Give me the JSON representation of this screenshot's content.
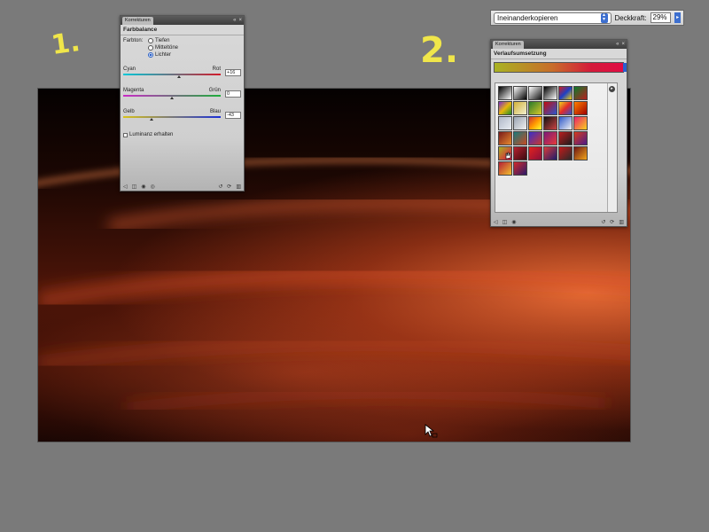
{
  "options_bar": {
    "blend_mode": "Ineinanderkopieren",
    "opacity_label": "Deckkraft:",
    "opacity_value": "29%"
  },
  "annotations": {
    "step1": "1.",
    "step2": "2."
  },
  "panel_color_balance": {
    "tab": "Korrekturen",
    "title": "Farbbalance",
    "tone_label": "Farbton:",
    "tones": [
      {
        "label": "Tiefen",
        "selected": false
      },
      {
        "label": "Mitteltöne",
        "selected": false
      },
      {
        "label": "Lichter",
        "selected": true
      }
    ],
    "sliders": [
      {
        "left": "Cyan",
        "right": "Rot",
        "value": "+16",
        "position": 0.57
      },
      {
        "left": "Magenta",
        "right": "Grün",
        "value": "0",
        "position": 0.5
      },
      {
        "left": "Gelb",
        "right": "Blau",
        "value": "-43",
        "position": 0.29
      }
    ],
    "luminance_label": "Luminanz erhalten",
    "luminance_checked": false
  },
  "panel_gradient_map": {
    "tab": "Korrekturen",
    "title": "Verlaufsumsetzung",
    "gradient_colors": [
      "#a9b322",
      "#c86d2a",
      "#d41b3a",
      "#e10c44"
    ]
  },
  "colors": {
    "annotation": "#f0e64a",
    "accent": "#2b61c7"
  }
}
